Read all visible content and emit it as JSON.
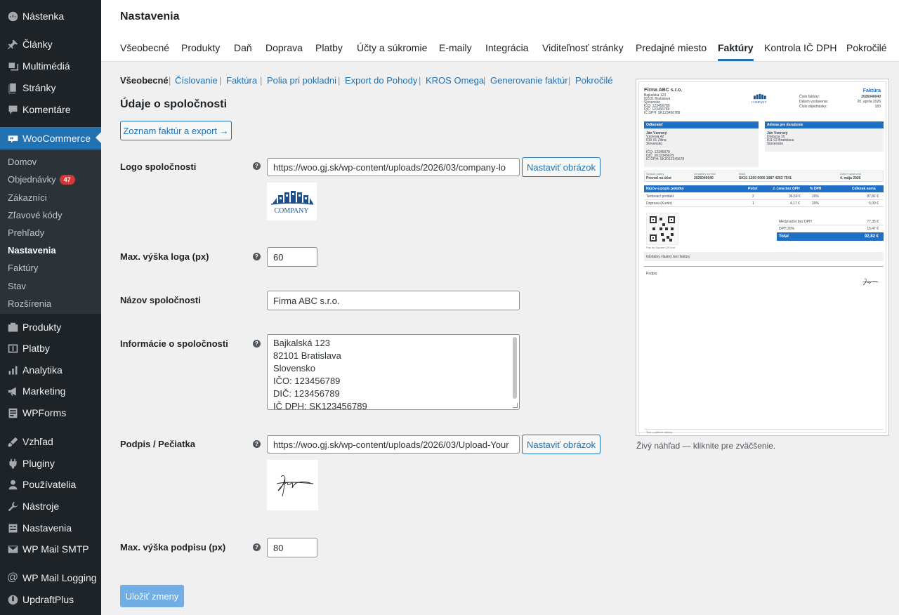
{
  "sidebar": {
    "items": [
      {
        "label": "Nástenka",
        "icon": "dashboard-icon"
      },
      {
        "label": "Články",
        "icon": "pin-icon"
      },
      {
        "label": "Multimédiá",
        "icon": "media-icon"
      },
      {
        "label": "Stránky",
        "icon": "pages-icon"
      },
      {
        "label": "Komentáre",
        "icon": "comments-icon"
      },
      {
        "label": "WooCommerce",
        "icon": "woocommerce-icon"
      },
      {
        "label": "Produkty",
        "icon": "products-icon"
      },
      {
        "label": "Platby",
        "icon": "payments-icon"
      },
      {
        "label": "Analytika",
        "icon": "analytics-icon"
      },
      {
        "label": "Marketing",
        "icon": "megaphone-icon"
      },
      {
        "label": "WPForms",
        "icon": "forms-icon"
      },
      {
        "label": "Vzhľad",
        "icon": "brush-icon"
      },
      {
        "label": "Pluginy",
        "icon": "plugin-icon"
      },
      {
        "label": "Používatelia",
        "icon": "users-icon"
      },
      {
        "label": "Nástroje",
        "icon": "wrench-icon"
      },
      {
        "label": "Nastavenia",
        "icon": "settings-icon"
      },
      {
        "label": "WP Mail SMTP",
        "icon": "mail-icon"
      },
      {
        "label": "WP Mail Logging",
        "icon": "at-icon"
      },
      {
        "label": "UpdraftPlus",
        "icon": "updraft-icon"
      }
    ],
    "submenu": [
      {
        "label": "Domov"
      },
      {
        "label": "Objednávky",
        "badge": "47"
      },
      {
        "label": "Zákazníci"
      },
      {
        "label": "Zľavové kódy"
      },
      {
        "label": "Prehľady"
      },
      {
        "label": "Nastavenia"
      },
      {
        "label": "Faktúry"
      },
      {
        "label": "Stav"
      },
      {
        "label": "Rozšírenia"
      }
    ]
  },
  "header": {
    "title": "Nastavenia",
    "tabs": [
      "Všeobecné",
      "Produkty",
      "Daň",
      "Doprava",
      "Platby",
      "Účty a súkromie",
      "E-maily",
      "Integrácia",
      "Viditeľnosť stránky",
      "Predajné miesto",
      "Faktúry",
      "Kontrola IČ DPH",
      "Pokročilé"
    ],
    "active_tab": "Faktúry"
  },
  "subnav": {
    "items": [
      "Všeobecné",
      "Číslovanie",
      "Faktúra",
      "Polia pri pokladni",
      "Export do Pohody",
      "KROS Omega",
      "Generovanie faktúr",
      "Pokročilé"
    ],
    "separator": "|"
  },
  "section": {
    "title": "Údaje o spoločnosti",
    "list_button": "Zoznam faktúr a export →"
  },
  "fields": {
    "logo": {
      "label": "Logo spoločnosti",
      "value": "https://woo.gj.sk/wp-content/uploads/2026/03/company-lo",
      "button": "Nastaviť obrázok",
      "logo_text": "COMPANY"
    },
    "logo_height": {
      "label": "Max. výška loga (px)",
      "value": "60"
    },
    "company_name": {
      "label": "Názov spoločnosti",
      "value": "Firma ABC s.r.o."
    },
    "company_info": {
      "label": "Informácie o spoločnosti",
      "lines": [
        "Bajkalská 123",
        "82101 Bratislava",
        "Slovensko",
        "IČO: 123456789",
        "DIČ: 123456789",
        "IČ DPH: SK123456789"
      ]
    },
    "signature": {
      "label": "Podpis / Pečiatka",
      "value": "https://woo.gj.sk/wp-content/uploads/2026/03/Upload-Your",
      "button": "Nastaviť obrázok"
    },
    "signature_height": {
      "label": "Max. výška podpisu (px)",
      "value": "80"
    }
  },
  "save_button": "Uložiť zmeny",
  "help_glyph": "?",
  "preview": {
    "caption": "Živý náhľad — kliknite pre zväčšenie.",
    "company": "Firma ABC s.r.o.",
    "company_lines": [
      "Bajkalská 123",
      "82101 Bratislava",
      "Slovensko",
      "IČO: 123456789",
      "DIČ: 123456789",
      "IČ DPH: SK123456789"
    ],
    "logo_text": "COMPANY",
    "doc_title": "Faktúra",
    "meta_labels": [
      "Číslo faktúry:",
      "Dátum vystavenia:",
      "Číslo objednávky:"
    ],
    "meta_values": [
      "2026040040",
      "20. apríla 2026",
      "183"
    ],
    "billing_title": "Odberateľ",
    "billing_lines": [
      "Ján Vzorový",
      "Vzorová 42",
      "010 01 Žilina",
      "Slovensko",
      "",
      "IČO: 12345678",
      "DIČ: 2012345678",
      "IČ DPH: SK2012345678"
    ],
    "shipping_title": "Adresa pre doručenie",
    "shipping_lines": [
      "Ján Vzorový",
      "Dodacia 15",
      "811 02 Bratislava",
      "Slovensko"
    ],
    "pay_labels": [
      "Spôsob platby",
      "Variabilný symbol",
      "IBAN",
      "Dátum splatnosti"
    ],
    "pay_values": [
      "Prevod na účet",
      "2026040040",
      "SK31 1200 0000 1987 4263 7541",
      "4. mája 2026"
    ],
    "table_headers": [
      "Názov a popis položky",
      "Počet",
      "J. cena bez DPH",
      "% DPH",
      "Celková suma"
    ],
    "rows": [
      [
        "Testovací produkt",
        "2",
        "36,59 €",
        "20%",
        "87,82 €"
      ],
      [
        "Doprava (Kuriér)",
        "1",
        "4,17 €",
        "20%",
        "5,00 €"
      ]
    ],
    "qr_caption": "Pay by Square QR kód",
    "totals": [
      [
        "Medzisúčet bez DPH",
        "77,35 €"
      ],
      [
        "DPH 20%",
        "15,47 €"
      ]
    ],
    "total_label": "Total",
    "total_value": "92,82 €",
    "global_note": "Globálny vlastný text faktúry",
    "sign_label": "Podpis:",
    "footer": "Text v pätičke faktúry"
  },
  "colors": {
    "accent": "#2271b1",
    "sidebar": "#1d2327",
    "submenu": "#2c3338",
    "badge": "#d63638",
    "invoice_blue": "#1f6fc4"
  }
}
